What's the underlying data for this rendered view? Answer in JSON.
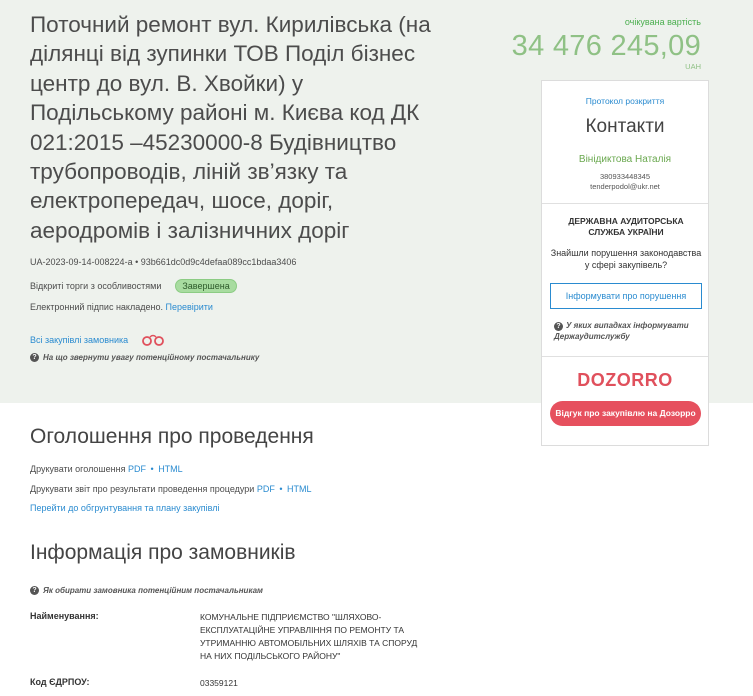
{
  "title": "Поточний ремонт вул. Кирилівська (на ділянці від зупинки ТОВ Поділ бізнес центр до вул. В. Хвойки) у Подільському районі м. Києва код ДК 021:2015 –45230000-8 Будівництво трубопроводів, ліній зв’язку та електропередач, шосе, доріг, аеродромів і залізничних доріг",
  "tender_id": "UA-2023-09-14-008224-a",
  "tender_hash": "93b661dc0d9c4defaa089cc1bdaa3406",
  "procedure_type": "Відкриті торги з особливостями",
  "status_badge": "Завершена",
  "signature_text": "Електронний підпис накладено.",
  "signature_link": "Перевірити",
  "all_purchases_link": "Всі закупівлі замовника",
  "attention_note": "На що звернути увагу потенційному постачальнику",
  "cost": {
    "label": "очікувана вартість",
    "value": "34 476 245,09",
    "currency": "UAH"
  },
  "sidebar": {
    "protocol_link": "Протокол розкриття",
    "contacts_heading": "Контакти",
    "person": "Вінідиктова Наталія",
    "phone": "380933448345",
    "email": "tenderpodol@ukr.net",
    "das_title": "ДЕРЖАВНА АУДИТОРСЬКА СЛУЖБА УКРАЇНИ",
    "das_text": "Знайшли порушення законодавства у сфері закупівель?",
    "inform_button": "Інформувати про порушення",
    "das_note": "У яких випадках інформувати Держаудитслужбу",
    "dozorro_logo": "DOZORRO",
    "dozorro_button": "Відгук про закупівлю на Дозорро"
  },
  "announcement": {
    "heading": "Оголошення про проведення",
    "print_announcement": "Друкувати оголошення",
    "print_report": "Друкувати звіт про результати проведення процедури",
    "pdf": "PDF",
    "html": "HTML",
    "justification_link": "Перейти до обгрунтування та плану закупівлі"
  },
  "customers": {
    "heading": "Інформація про замовників",
    "note": "Як обирати замовника потенційним постачальникам",
    "name_label": "Найменування:",
    "name_value": "КОМУНАЛЬНЕ ПІДПРИЄМСТВО \"ШЛЯХОВО-ЕКСПЛУАТАЦІЙНЕ УПРАВЛІННЯ ПО РЕМОНТУ ТА УТРИМАННЮ АВТОМОБІЛЬНИХ ШЛЯХІВ ТА СПОРУД НА НИХ ПОДІЛЬСЬКОГО РАЙОНУ\"",
    "edrpou_label": "Код ЄДРПОУ:",
    "edrpou_value": "03359121"
  },
  "colors": {
    "accent_blue": "#2a8bd0",
    "cost_green": "#8fc185",
    "dozorro_red": "#e6505e",
    "badge_green": "#a8dca0"
  }
}
